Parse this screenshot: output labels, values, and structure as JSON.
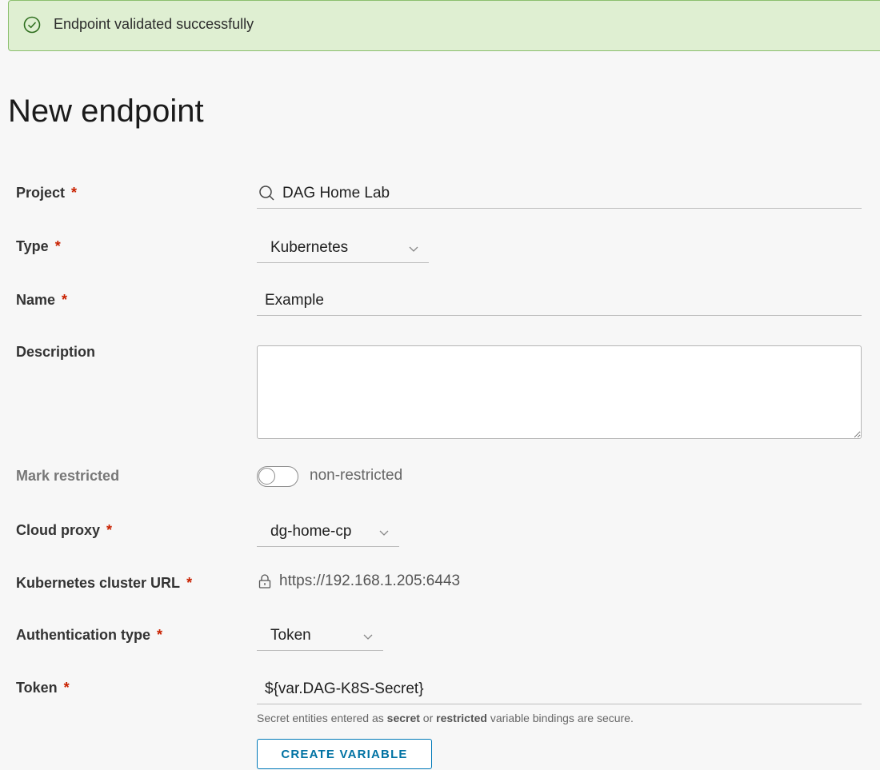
{
  "alert": {
    "message": "Endpoint validated successfully",
    "icon": "check-circle-icon"
  },
  "page": {
    "title": "New endpoint"
  },
  "form": {
    "project": {
      "label": "Project",
      "required": "*",
      "value": "DAG Home Lab",
      "icon": "search-icon"
    },
    "type": {
      "label": "Type",
      "required": "*",
      "value": "Kubernetes"
    },
    "name": {
      "label": "Name",
      "required": "*",
      "value": "Example"
    },
    "description": {
      "label": "Description",
      "value": ""
    },
    "mark_restricted": {
      "label": "Mark restricted",
      "state_text": "non-restricted",
      "on": false
    },
    "cloud_proxy": {
      "label": "Cloud proxy",
      "required": "*",
      "value": "dg-home-cp"
    },
    "cluster_url": {
      "label": "Kubernetes cluster URL",
      "required": "*",
      "value": "https://192.168.1.205:6443",
      "icon": "lock-icon"
    },
    "auth_type": {
      "label": "Authentication type",
      "required": "*",
      "value": "Token"
    },
    "token": {
      "label": "Token",
      "required": "*",
      "value": "${var.DAG-K8S-Secret}",
      "help_prefix": "Secret entities entered as ",
      "help_secret": "secret",
      "help_or": " or ",
      "help_restricted": "restricted",
      "help_suffix": " variable bindings are secure."
    },
    "create_variable_button": "CREATE VARIABLE"
  },
  "colors": {
    "accent": "#0072a3",
    "required": "#c92100",
    "success_bg": "#dfefd2",
    "success_border": "#8bbf6e"
  }
}
